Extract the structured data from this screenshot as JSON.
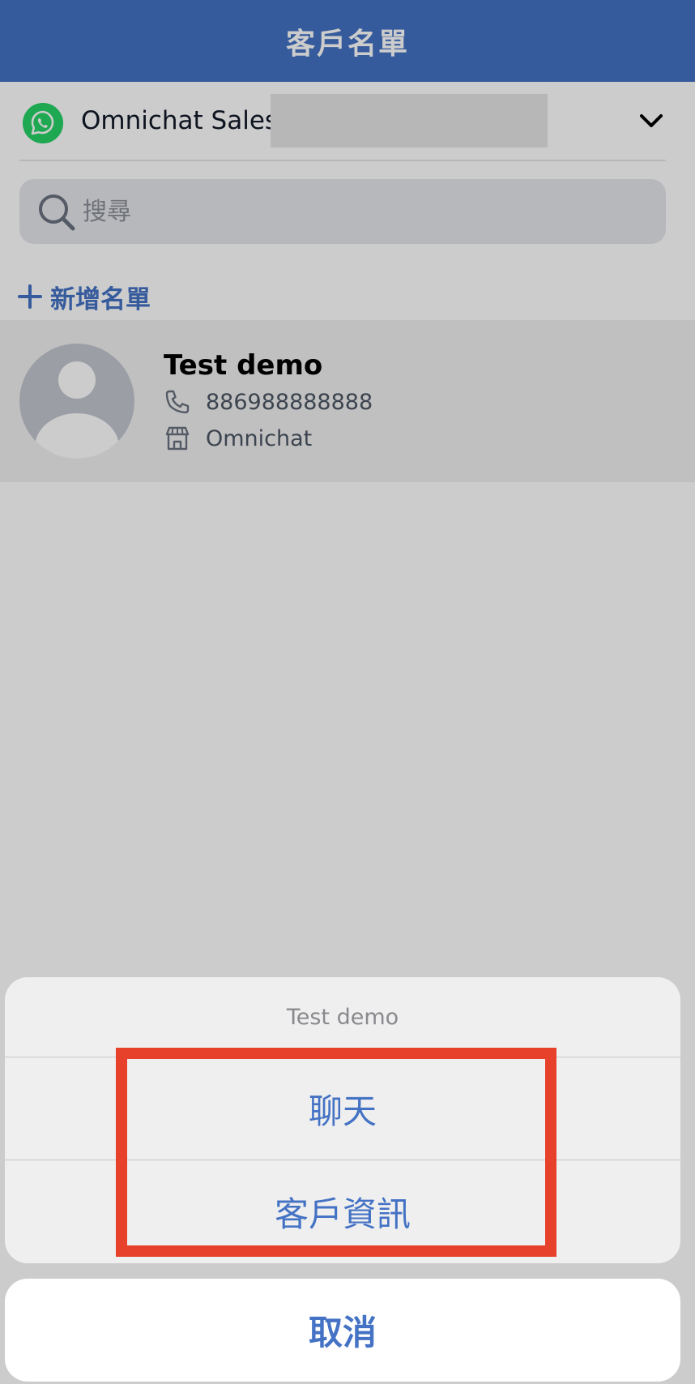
{
  "header": {
    "title": "客戶名單"
  },
  "channel": {
    "icon": "whatsapp-icon",
    "name": "Omnichat Sales",
    "dropdown_icon": "chevron-down-icon"
  },
  "search": {
    "placeholder": "搜尋",
    "value": ""
  },
  "add_list": {
    "label": "新增名單"
  },
  "contacts": [
    {
      "name": "Test demo",
      "phone": "886988888888",
      "store": "Omnichat"
    }
  ],
  "action_sheet": {
    "title": "Test demo",
    "options": [
      {
        "label": "聊天"
      },
      {
        "label": "客戶資訊"
      }
    ],
    "cancel_label": "取消"
  },
  "colors": {
    "primary": "#4472c4",
    "whatsapp": "#25d366",
    "highlight": "#e8412b"
  }
}
